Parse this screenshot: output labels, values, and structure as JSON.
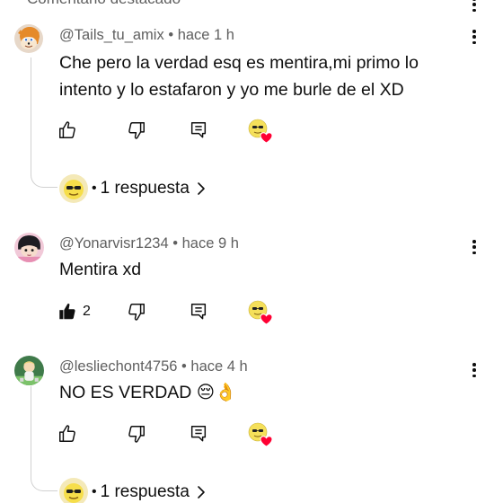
{
  "section_header": "Comentario destacado",
  "comments": [
    {
      "author": "@Tails_tu_amix",
      "time": "hace 1 h",
      "text_lines": [
        "Che pero la verdad esq es mentira,mi primo lo",
        "intento y lo estafaron y yo me burle de el XD"
      ],
      "like_count": "",
      "replies_label": "1 respuesta"
    },
    {
      "author": "@Yonarvisr1234",
      "time": "hace 9 h",
      "text_lines": [
        "Mentira xd"
      ],
      "like_count": "2"
    },
    {
      "author": "@lesliechont4756",
      "time": "hace 4 h",
      "text_lines": [
        "NO ES VERDAD 😔👌"
      ],
      "like_count": "",
      "replies_label": "1 respuesta"
    }
  ],
  "separator": "•",
  "icons": {
    "like": "thumb-up-icon",
    "dislike": "thumb-down-icon",
    "reply": "reply-comment-icon",
    "creator_heart": "creator-heart-badge",
    "more": "more-vert-icon",
    "chevron": "chevron-right-icon"
  },
  "colors": {
    "heart": "#ff0033",
    "meta": "#606060",
    "text": "#0f0f0f",
    "line": "#d0d0d0"
  }
}
